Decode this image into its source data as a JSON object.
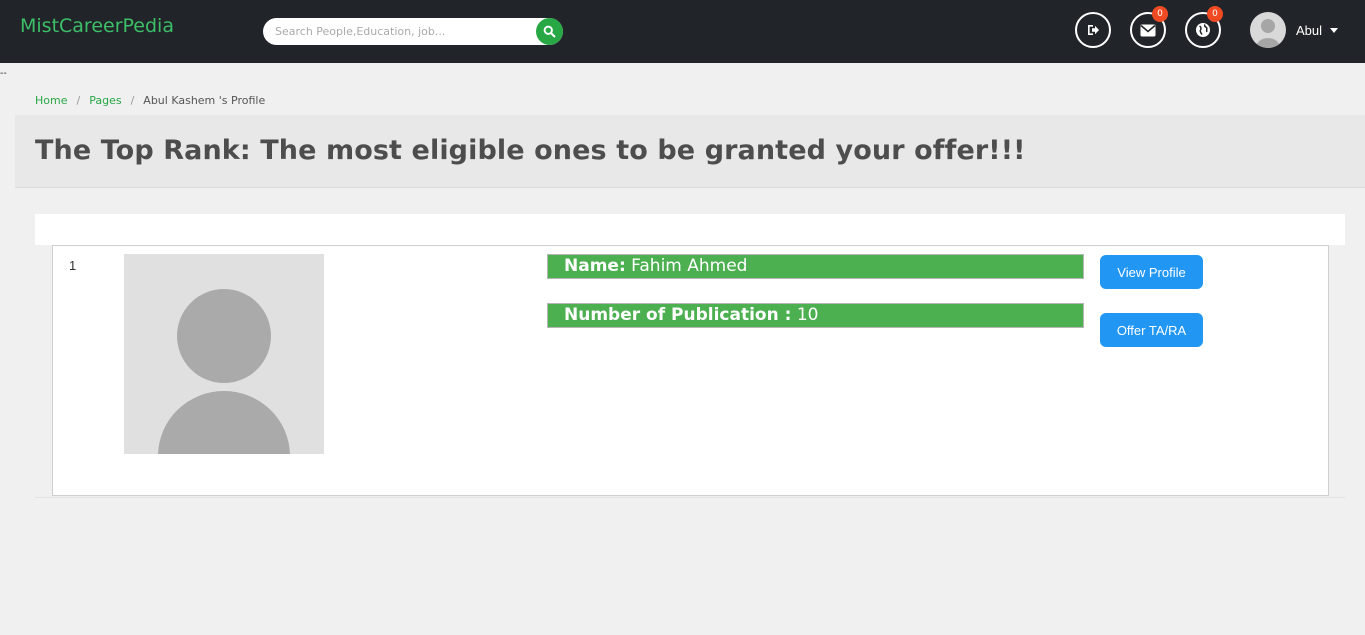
{
  "header": {
    "brand": "MistCareerPedia",
    "search": {
      "placeholder": "Search People,Education, job..."
    },
    "icons": {
      "logout": "sign-out-icon",
      "messages": {
        "icon": "envelope-icon",
        "badge": "0"
      },
      "notifications": {
        "icon": "globe-icon",
        "badge": "0"
      }
    },
    "user": {
      "name": "Abul"
    }
  },
  "stray_text": "--",
  "breadcrumb": {
    "home": "Home",
    "pages": "Pages",
    "current": "Abul Kashem 's Profile",
    "separator": "/"
  },
  "page_title": "The Top Rank: The most eligible ones to be granted your offer!!!",
  "ranking": [
    {
      "rank": "1",
      "name_label": "Name:",
      "name": "Fahim Ahmed",
      "publication_label": "Number of Publication :",
      "publications": "10",
      "view_button": "View Profile",
      "offer_button": "Offer TA/RA"
    }
  ],
  "colors": {
    "brand": "#3cbf67",
    "topbar": "#212529",
    "info_bar": "#4caf50",
    "button": "#2196f3",
    "badge": "#f04a23"
  }
}
